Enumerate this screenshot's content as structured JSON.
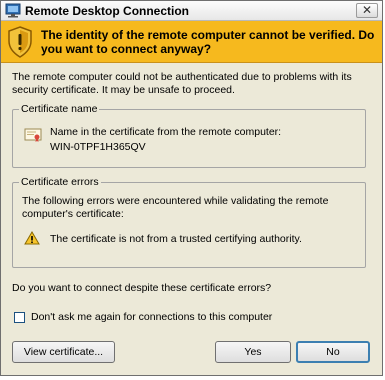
{
  "window": {
    "title": "Remote Desktop Connection",
    "close_label": "✕"
  },
  "banner": {
    "text": "The identity of the remote computer cannot be verified. Do you want to connect anyway?"
  },
  "intro": {
    "text": "The remote computer could not be authenticated due to problems with its security certificate. It may be unsafe to proceed."
  },
  "certificate_name": {
    "title": "Certificate name",
    "label": "Name in the certificate from the remote computer:",
    "value": "WIN-0TPF1H365QV"
  },
  "certificate_errors": {
    "title": "Certificate errors",
    "description": "The following errors were encountered while validating the remote computer's certificate:",
    "error": "The certificate is not from a trusted certifying authority."
  },
  "question": {
    "text": "Do you want to connect despite these certificate errors?"
  },
  "dont_ask": {
    "label": "Don't ask me again for connections to this computer",
    "checked": false
  },
  "buttons": {
    "view_certificate": "View certificate...",
    "yes": "Yes",
    "no": "No"
  },
  "colors": {
    "banner": "#f6b91e",
    "dialog_background": "#ece9d8",
    "default_button_border": "#3c7fb1"
  },
  "icons": {
    "title": "remote-desktop-icon",
    "banner": "security-shield-warning-icon",
    "certificate": "certificate-icon",
    "error": "warning-triangle-icon"
  }
}
